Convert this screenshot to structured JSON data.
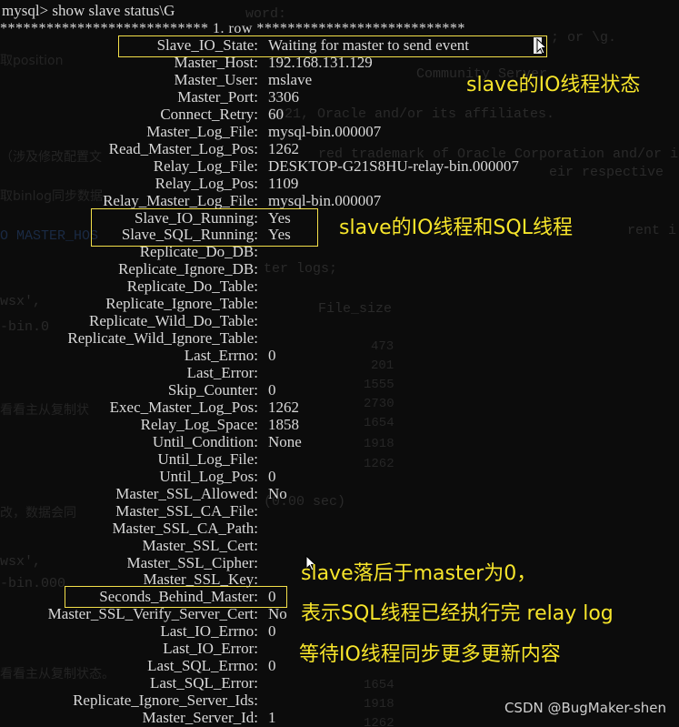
{
  "terminal": {
    "prompt": "mysql> show slave status\\G",
    "row_header": "*************************** 1. row ***************************",
    "fields": [
      {
        "key": "Slave_IO_State:",
        "value": "Waiting for master to send event"
      },
      {
        "key": "Master_Host:",
        "value": "192.168.131.129"
      },
      {
        "key": "Master_User:",
        "value": "mslave"
      },
      {
        "key": "Master_Port:",
        "value": "3306"
      },
      {
        "key": "Connect_Retry:",
        "value": "60"
      },
      {
        "key": "Master_Log_File:",
        "value": "mysql-bin.000007"
      },
      {
        "key": "Read_Master_Log_Pos:",
        "value": "1262"
      },
      {
        "key": "Relay_Log_File:",
        "value": "DESKTOP-G21S8HU-relay-bin.000007"
      },
      {
        "key": "Relay_Log_Pos:",
        "value": "1109"
      },
      {
        "key": "Relay_Master_Log_File:",
        "value": "mysql-bin.000007"
      },
      {
        "key": "Slave_IO_Running:",
        "value": "Yes"
      },
      {
        "key": "Slave_SQL_Running:",
        "value": "Yes"
      },
      {
        "key": "Replicate_Do_DB:",
        "value": ""
      },
      {
        "key": "Replicate_Ignore_DB:",
        "value": ""
      },
      {
        "key": "Replicate_Do_Table:",
        "value": ""
      },
      {
        "key": "Replicate_Ignore_Table:",
        "value": ""
      },
      {
        "key": "Replicate_Wild_Do_Table:",
        "value": ""
      },
      {
        "key": "Replicate_Wild_Ignore_Table:",
        "value": ""
      },
      {
        "key": "Last_Errno:",
        "value": "0"
      },
      {
        "key": "Last_Error:",
        "value": ""
      },
      {
        "key": "Skip_Counter:",
        "value": "0"
      },
      {
        "key": "Exec_Master_Log_Pos:",
        "value": "1262"
      },
      {
        "key": "Relay_Log_Space:",
        "value": "1858"
      },
      {
        "key": "Until_Condition:",
        "value": "None"
      },
      {
        "key": "Until_Log_File:",
        "value": ""
      },
      {
        "key": "Until_Log_Pos:",
        "value": "0"
      },
      {
        "key": "Master_SSL_Allowed:",
        "value": "No"
      },
      {
        "key": "Master_SSL_CA_File:",
        "value": ""
      },
      {
        "key": "Master_SSL_CA_Path:",
        "value": ""
      },
      {
        "key": "Master_SSL_Cert:",
        "value": ""
      },
      {
        "key": "Master_SSL_Cipher:",
        "value": ""
      },
      {
        "key": "Master_SSL_Key:",
        "value": ""
      },
      {
        "key": "Seconds_Behind_Master:",
        "value": "0"
      },
      {
        "key": "Master_SSL_Verify_Server_Cert:",
        "value": "No"
      },
      {
        "key": "Last_IO_Errno:",
        "value": "0"
      },
      {
        "key": "Last_IO_Error:",
        "value": ""
      },
      {
        "key": "Last_SQL_Errno:",
        "value": "0"
      },
      {
        "key": "Last_SQL_Error:",
        "value": ""
      },
      {
        "key": "Replicate_Ignore_Server_Ids:",
        "value": ""
      },
      {
        "key": "Master_Server_Id:",
        "value": "1"
      }
    ]
  },
  "background": {
    "lines": [
      "word:",
      "; or \\g.",
      "Community Server",
      "2021, Oracle and/or its affiliates.",
      "red trademark of Oracle Corporation and/or i",
      "eir respective",
      "rent i",
      "ter logs;",
      "File_size",
      "wsx',",
      "-bin.0",
      "(0.00 sec)",
      "wsx',",
      "-bin.000"
    ],
    "cjk": [
      "取position",
      "（涉及修改配置文",
      "取binlog同步数据",
      "O MASTER_HOS",
      "看看主从复制状",
      "改，数据会同",
      "看看主从复制状态。"
    ],
    "table_numbers": [
      "473",
      "201",
      "1555",
      "2730",
      "1654",
      "1918",
      "1262",
      "1654",
      "1918",
      "1262"
    ]
  },
  "annotations": {
    "io_state": "slave的IO线程状态",
    "running": "slave的IO线程和SQL线程",
    "behind_line1": "slave落后于master为0，",
    "behind_line2": "表示SQL线程已经执行完 relay log",
    "behind_line3": "等待IO线程同步更多更新内容"
  },
  "watermark": "CSDN @BugMaker-shen",
  "colors": {
    "background": "#0c0c0c",
    "text": "#d9d9d9",
    "annotation": "#f7e52b",
    "highlight_box": "#f4e04a"
  }
}
